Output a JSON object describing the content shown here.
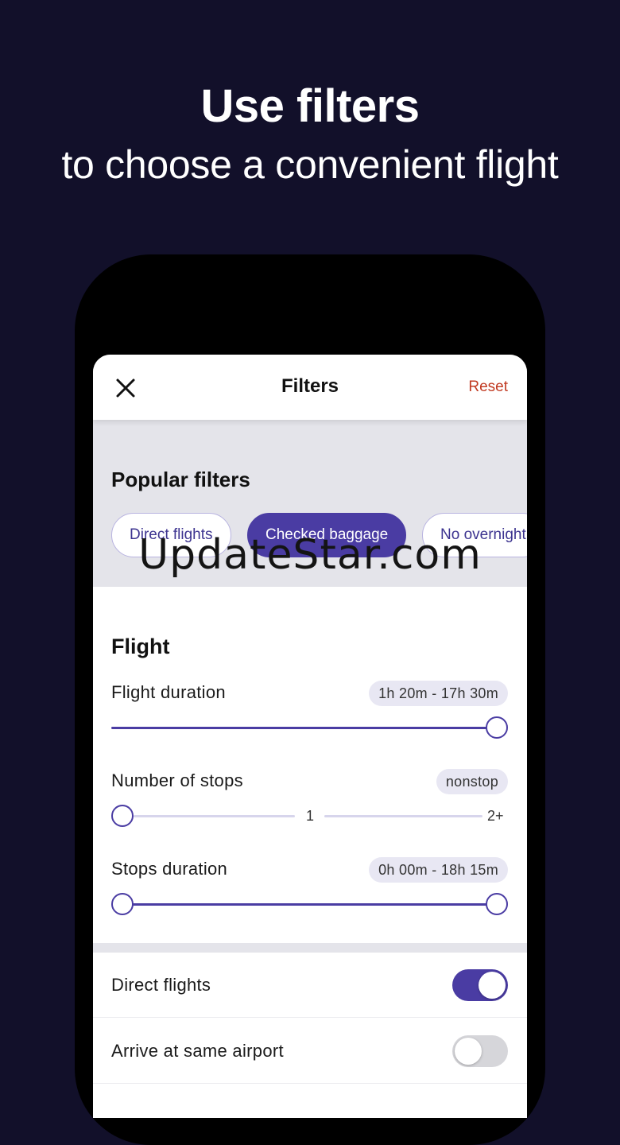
{
  "headline": {
    "title": "Use filters",
    "subtitle": "to choose a convenient flight"
  },
  "header": {
    "title": "Filters",
    "reset_label": "Reset",
    "close_icon": "close-icon"
  },
  "popular": {
    "title": "Popular filters",
    "chips": [
      {
        "label": "Direct flights",
        "active": false
      },
      {
        "label": "Checked baggage",
        "active": true
      },
      {
        "label": "No overnight",
        "active": false
      }
    ]
  },
  "watermark": "UpdateStar.com",
  "flight": {
    "title": "Flight",
    "duration": {
      "label": "Flight duration",
      "value": "1h 20m - 17h 30m"
    },
    "stops": {
      "label": "Number of stops",
      "value": "nonstop",
      "ticks": [
        "1",
        "2+"
      ]
    },
    "stops_duration": {
      "label": "Stops duration",
      "value": "0h 00m - 18h 15m"
    }
  },
  "toggles": [
    {
      "label": "Direct flights",
      "on": true
    },
    {
      "label": "Arrive at same airport",
      "on": false
    }
  ],
  "colors": {
    "accent": "#4a3ca3",
    "reset": "#c13a22",
    "background": "#12102a"
  }
}
